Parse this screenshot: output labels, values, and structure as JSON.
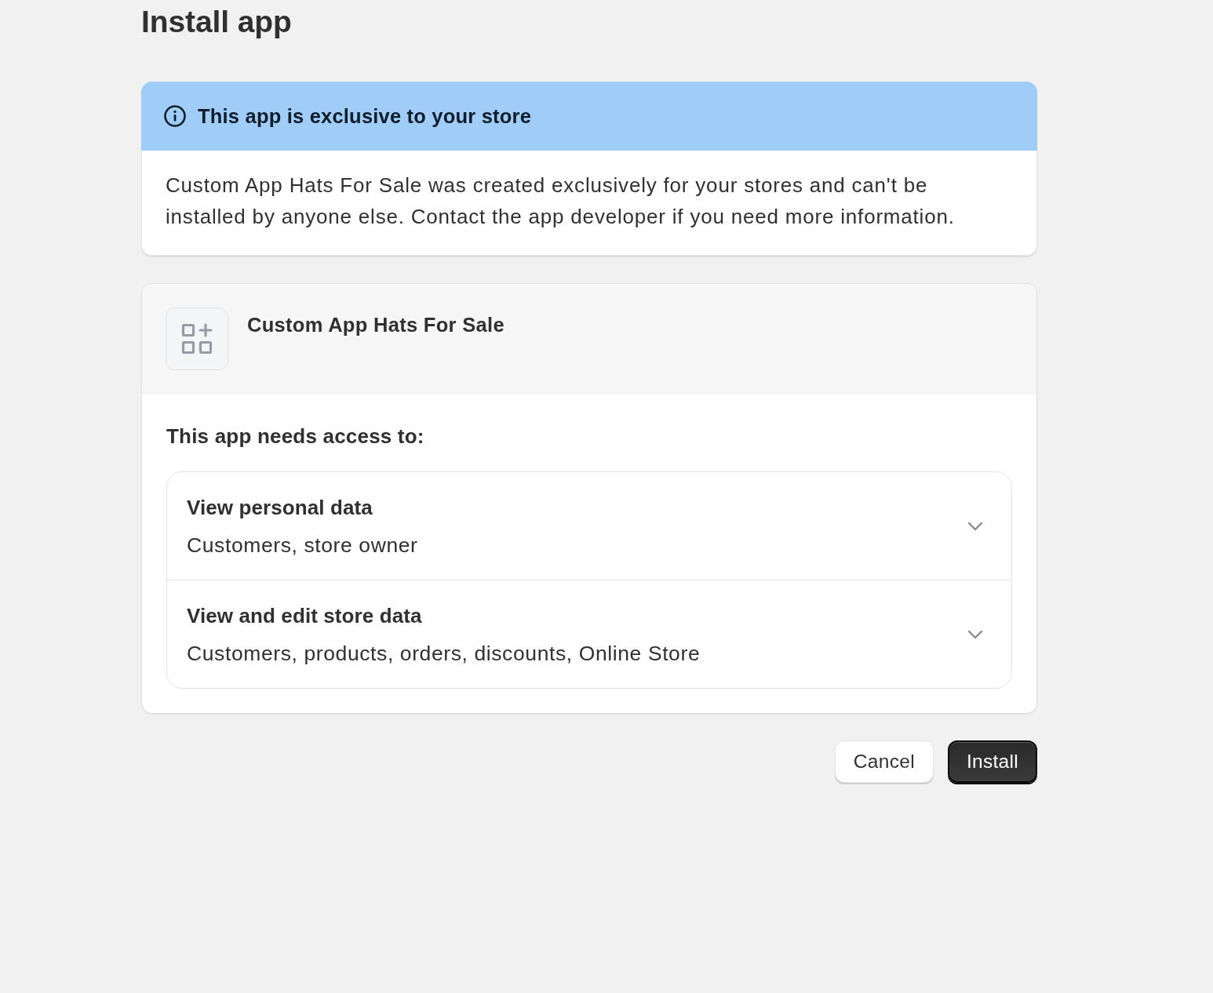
{
  "page": {
    "title": "Install app"
  },
  "notice": {
    "title": "This app is exclusive to your store",
    "body": "Custom App Hats For Sale was created exclusively for your stores and can't be installed by anyone else. Contact the app developer if you need more information."
  },
  "app": {
    "name": "Custom App Hats For Sale"
  },
  "access": {
    "heading": "This app needs access to:",
    "permissions": [
      {
        "title": "View personal data",
        "description": "Customers, store owner",
        "expanded": false
      },
      {
        "title": "View and edit store data",
        "description": "Customers, products, orders, discounts, Online Store",
        "expanded": false
      }
    ]
  },
  "buttons": [
    {
      "label": "Cancel",
      "kind": "secondary"
    },
    {
      "label": "Install",
      "kind": "primary"
    }
  ]
}
